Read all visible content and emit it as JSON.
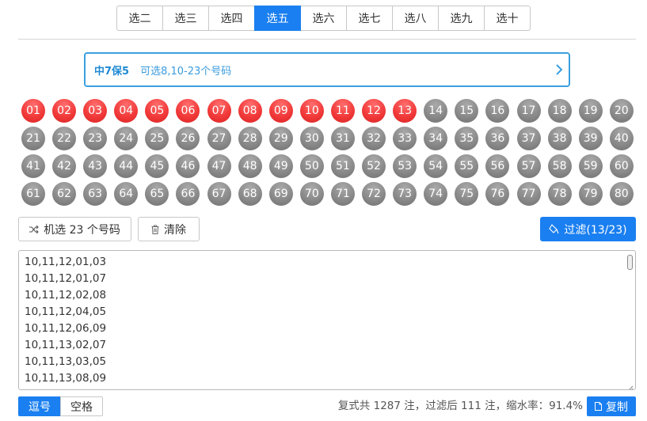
{
  "tabs": [
    "选二",
    "选三",
    "选四",
    "选五",
    "选六",
    "选七",
    "选八",
    "选九",
    "选十"
  ],
  "active_tab": "选五",
  "rule": {
    "name": "中7保5",
    "description": "可选8,10-23个号码"
  },
  "balls": {
    "rows": [
      [
        "01",
        "02",
        "03",
        "04",
        "05",
        "06",
        "07",
        "08",
        "09",
        "10",
        "11",
        "12",
        "13",
        "14",
        "15",
        "16",
        "17",
        "18",
        "19",
        "20"
      ],
      [
        "21",
        "22",
        "23",
        "24",
        "25",
        "26",
        "27",
        "28",
        "29",
        "30",
        "31",
        "32",
        "33",
        "34",
        "35",
        "36",
        "37",
        "38",
        "39",
        "40"
      ],
      [
        "41",
        "42",
        "43",
        "44",
        "45",
        "46",
        "47",
        "48",
        "49",
        "50",
        "51",
        "52",
        "53",
        "54",
        "55",
        "56",
        "57",
        "58",
        "59",
        "60"
      ],
      [
        "61",
        "62",
        "63",
        "64",
        "65",
        "66",
        "67",
        "68",
        "69",
        "70",
        "71",
        "72",
        "73",
        "74",
        "75",
        "76",
        "77",
        "78",
        "79",
        "80"
      ]
    ],
    "selected": [
      "01",
      "02",
      "03",
      "04",
      "05",
      "06",
      "07",
      "08",
      "09",
      "10",
      "11",
      "12",
      "13"
    ]
  },
  "actions": {
    "random_label": "机选 23 个号码",
    "clear_label": "清除",
    "filter_label": "过滤(13/23)"
  },
  "results": [
    "10,11,12,01,03",
    "10,11,12,01,07",
    "10,11,12,02,08",
    "10,11,12,04,05",
    "10,11,12,06,09",
    "10,11,13,02,07",
    "10,11,13,03,05",
    "10,11,13,08,09"
  ],
  "separators": {
    "comma_label": "逗号",
    "space_label": "空格",
    "active": "逗号"
  },
  "stats": "复式共 1287 注，过滤后 111 注，缩水率：91.4%",
  "copy_label": "复制",
  "colors": {
    "accent": "#1a7ff0",
    "selected_ball": "#f23a3a",
    "unselected_ball": "#8a8a8a",
    "rule_text": "#1f8ad4"
  },
  "icons": {
    "rule_arrow": "chevron-right-icon",
    "random": "shuffle-icon",
    "clear": "trash-icon",
    "filter": "filter-icon",
    "copy": "copy-icon"
  }
}
